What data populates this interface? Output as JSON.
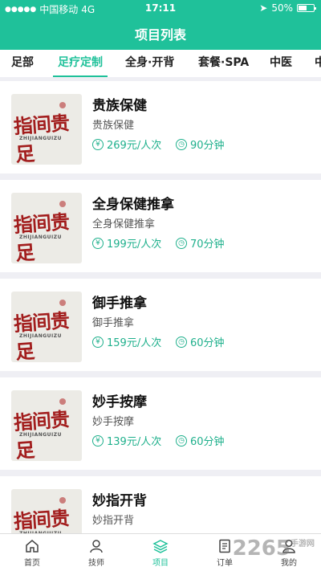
{
  "status_bar": {
    "carrier": "中国移动",
    "network": "4G",
    "time": "17:11",
    "battery": "50%"
  },
  "header": {
    "title": "项目列表"
  },
  "tabs": [
    {
      "label": "足部"
    },
    {
      "label": "足疗定制"
    },
    {
      "label": "全身·开背"
    },
    {
      "label": "套餐·SPA"
    },
    {
      "label": "中医"
    },
    {
      "label": "中"
    }
  ],
  "thumb": {
    "logo_text": "指间贵足",
    "logo_sub": "ZHIJIANGUIZU"
  },
  "items": [
    {
      "name": "贵族保健",
      "desc": "贵族保健",
      "price": "269元/人次",
      "duration": "90分钟"
    },
    {
      "name": "全身保健推拿",
      "desc": "全身保健推拿",
      "price": "199元/人次",
      "duration": "70分钟"
    },
    {
      "name": "御手推拿",
      "desc": "御手推拿",
      "price": "159元/人次",
      "duration": "60分钟"
    },
    {
      "name": "妙手按摩",
      "desc": "妙手按摩",
      "price": "139元/人次",
      "duration": "60分钟"
    },
    {
      "name": "妙指开背",
      "desc": "妙指开背",
      "price": "",
      "duration": ""
    }
  ],
  "bottom_nav": [
    {
      "label": "首页",
      "icon": "home-icon"
    },
    {
      "label": "技师",
      "icon": "technician-icon"
    },
    {
      "label": "项目",
      "icon": "layers-icon"
    },
    {
      "label": "订单",
      "icon": "order-icon"
    },
    {
      "label": "我的",
      "icon": "user-icon"
    }
  ],
  "watermark": {
    "text": "2265",
    "suffix": "手游网"
  },
  "colors": {
    "accent": "#1fc19a",
    "price": "#1fb08c",
    "logo_red": "#a21d1d"
  }
}
